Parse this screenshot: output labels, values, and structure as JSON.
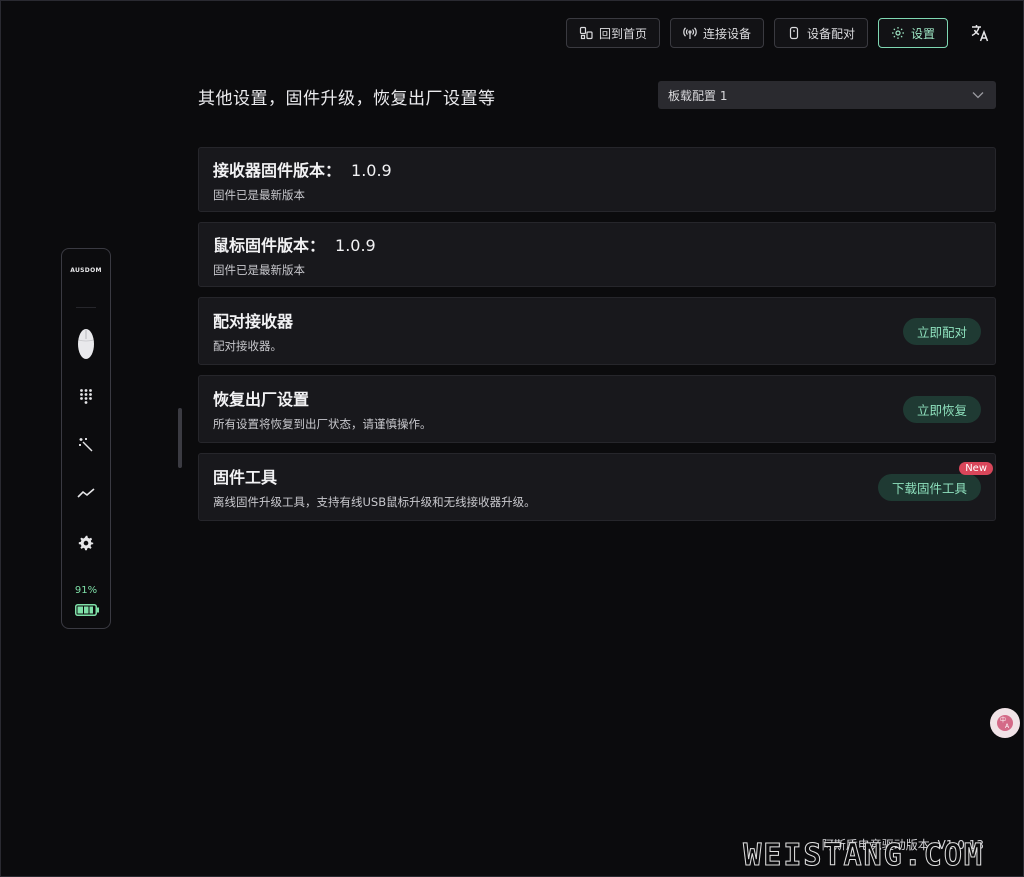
{
  "nav": {
    "home": "回到首页",
    "connect": "连接设备",
    "pair": "设备配对",
    "settings": "设置"
  },
  "header": {
    "title": "其他设置，固件升级，恢复出厂设置等",
    "profile_selected": "板载配置 1"
  },
  "cards": {
    "receiver_fw": {
      "title": "接收器固件版本：",
      "version": "1.0.9",
      "desc": "固件已是最新版本"
    },
    "mouse_fw": {
      "title": "鼠标固件版本：",
      "version": "1.0.9",
      "desc": "固件已是最新版本"
    },
    "pair_receiver": {
      "title": "配对接收器",
      "desc": "配对接收器。",
      "button": "立即配对"
    },
    "factory_reset": {
      "title": "恢复出厂设置",
      "desc": "所有设置将恢复到出厂状态，请谨慎操作。",
      "button": "立即恢复"
    },
    "fw_tool": {
      "title": "固件工具",
      "desc": "离线固件升级工具，支持有线USB鼠标升级和无线接收器升级。",
      "button": "下载固件工具",
      "badge": "New"
    }
  },
  "sidebar": {
    "brand": "AUSDOM",
    "battery_pct": "91%",
    "battery_level": 0.91,
    "icons": [
      "mouse-icon",
      "keypad-icon",
      "magic-wand-icon",
      "trend-icon",
      "gear-icon"
    ]
  },
  "footer": {
    "version": "阿斯盾电竞驱动版本: V1.0.13",
    "watermark": "WEISTANG.COM"
  },
  "colors": {
    "accent": "#8ee0bd",
    "accent_bg": "#1f3a33",
    "badge": "#d9465a",
    "battery": "#7fe0a8"
  }
}
